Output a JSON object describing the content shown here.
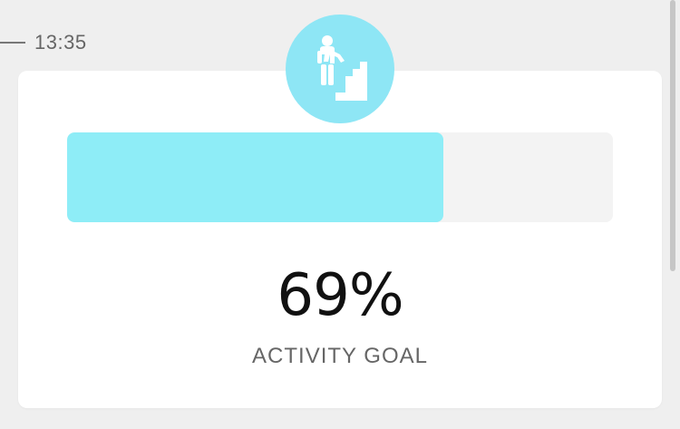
{
  "timeline": {
    "time": "13:35"
  },
  "activity": {
    "icon": "stairs-climber-icon",
    "progress_percent": 69,
    "percent_label": "69%",
    "goal_label": "ACTIVITY GOAL"
  },
  "colors": {
    "accent": "#8ee6f5",
    "progress_fill": "#8eedf7",
    "progress_track": "#f3f3f3",
    "card_background": "#ffffff",
    "page_background": "#efefef"
  },
  "scroll": {
    "position_percent": 0
  }
}
